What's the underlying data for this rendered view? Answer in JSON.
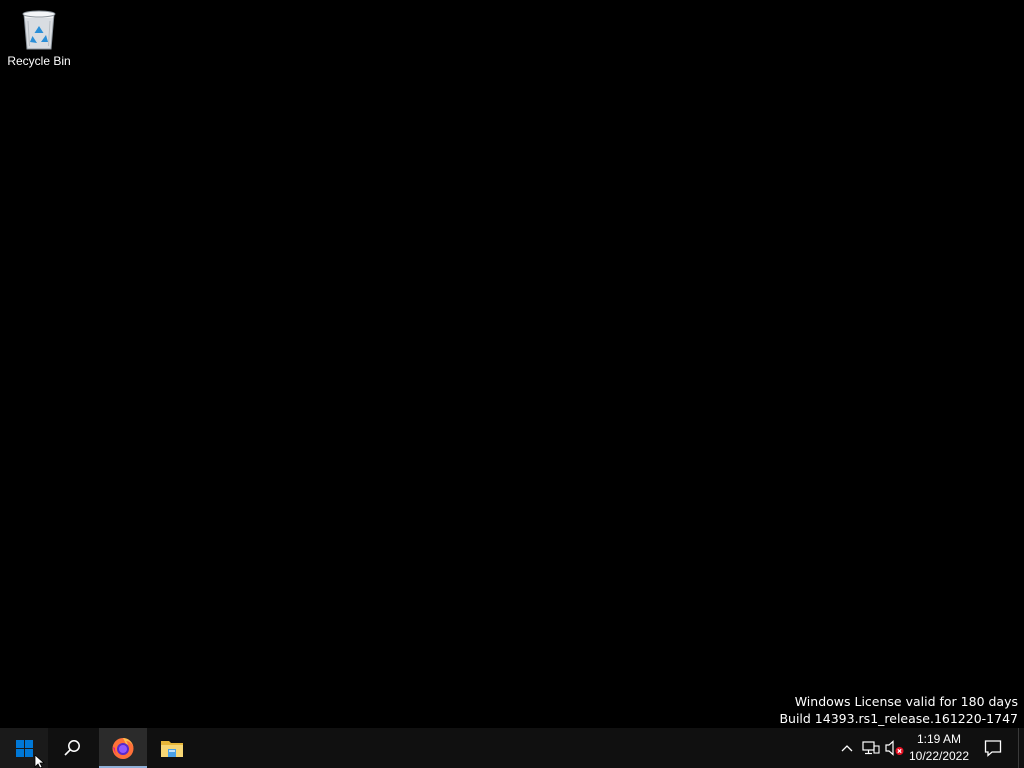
{
  "desktop": {
    "icons": [
      {
        "label": "Recycle Bin",
        "icon": "recycle-bin-icon"
      }
    ],
    "watermark": {
      "line1": "Windows License valid for 180 days",
      "line2": "Build 14393.rs1_release.161220-1747"
    }
  },
  "taskbar": {
    "start_icon": "windows-logo-icon",
    "search_icon": "search-icon",
    "pinned_apps": [
      {
        "icon": "firefox-icon",
        "active": true
      },
      {
        "icon": "file-explorer-icon",
        "active": false
      }
    ],
    "tray": {
      "chevron_icon": "chevron-up-icon",
      "network_icon": "network-icon",
      "volume_icon": "volume-muted-icon",
      "time": "1:19 AM",
      "date": "10/22/2022",
      "notification_icon": "action-center-icon"
    }
  },
  "colors": {
    "desktop_bg": "#000000",
    "taskbar_bg": "#101010",
    "windows_blue": "#0078d7",
    "active_underline": "#8fb0d8",
    "muted_red": "#e81123"
  }
}
